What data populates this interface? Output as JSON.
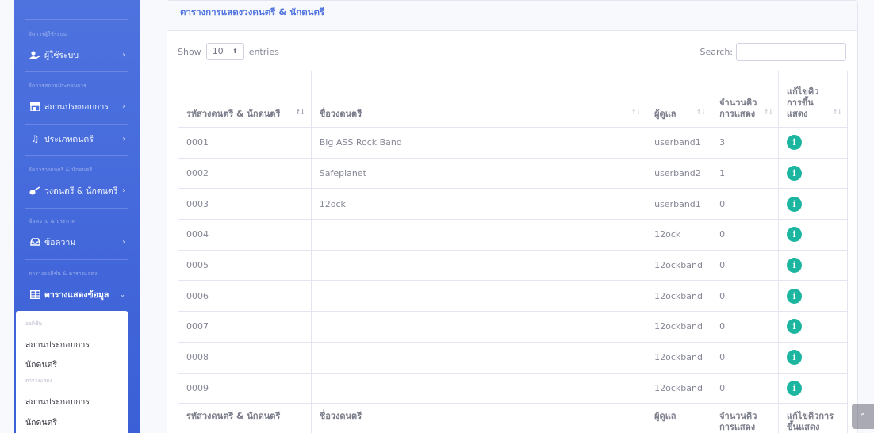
{
  "sidebar": {
    "sections": [
      {
        "heading": "จัดการผู้ใช้ระบบ",
        "item": "ผู้ใช้ระบบ"
      },
      {
        "heading": "จัดการสถานประกอบการ",
        "item": "สถานประกอบการ"
      },
      {
        "heading": "",
        "item": "ประเภทดนตรี"
      },
      {
        "heading": "จัดการวงดนตรี & นักดนตรี",
        "item": "วงดนตรี & นักดนตรี"
      },
      {
        "heading": "ข้อความ & ประกาศ",
        "item": "ข้อความ"
      },
      {
        "heading": "ตารางออดิชั่น & ตารางแสดง",
        "item": "ตารางแสดงข้อมูล"
      }
    ],
    "submenu": {
      "heading1": "ออดิชั่น",
      "items1": [
        "สถานประกอบการ",
        "นักดนตรี"
      ],
      "heading2": "ตารางแสดง",
      "items2": [
        "สถานประกอบการ",
        "นักดนตรี"
      ]
    }
  },
  "card": {
    "title": "ตารางการแสดงวงดนตรี & นักดนตรี",
    "show_label": "Show",
    "entries_value": "10",
    "entries_label": "entries",
    "search_label": "Search:",
    "search_value": ""
  },
  "table": {
    "headers": [
      "รหัสวงดนตรี & นักดนตรี",
      "ชื่อวงดนตรี",
      "ผู้ดูแล",
      "จำนวนคิวการแสดง",
      "แก้ไขคิวการขึ้นแสดง"
    ],
    "header_lines": {
      "count": [
        "จำนวนคิว",
        "การแสดง"
      ],
      "edit": [
        "แก้ไขคิว",
        "การขึ้น",
        "แสดง"
      ]
    },
    "footer_lines": {
      "count": [
        "จำนวนคิว",
        "การแสดง"
      ],
      "edit": [
        "แก้ไขคิวการ",
        "ขึ้นแสดง"
      ]
    },
    "rows": [
      {
        "id": "0001",
        "name": "Big ASS Rock Band",
        "owner": "userband1",
        "count": "3"
      },
      {
        "id": "0002",
        "name": "Safeplanet",
        "owner": "userband2",
        "count": "1"
      },
      {
        "id": "0003",
        "name": "12ock",
        "owner": "userband1",
        "count": "0"
      },
      {
        "id": "0004",
        "name": "",
        "owner": "12ock",
        "count": "0"
      },
      {
        "id": "0005",
        "name": "",
        "owner": "12ockband",
        "count": "0"
      },
      {
        "id": "0006",
        "name": "",
        "owner": "12ockband",
        "count": "0"
      },
      {
        "id": "0007",
        "name": "",
        "owner": "12ockband",
        "count": "0"
      },
      {
        "id": "0008",
        "name": "",
        "owner": "12ockband",
        "count": "0"
      },
      {
        "id": "0009",
        "name": "",
        "owner": "12ockband",
        "count": "0"
      }
    ]
  },
  "colors": {
    "sidebar": "#4e73df",
    "title": "#4e73df",
    "info_button": "#1bb5a0"
  },
  "icons": {
    "info": "info-circle-icon",
    "scroll_top": "chevron-up-icon"
  }
}
